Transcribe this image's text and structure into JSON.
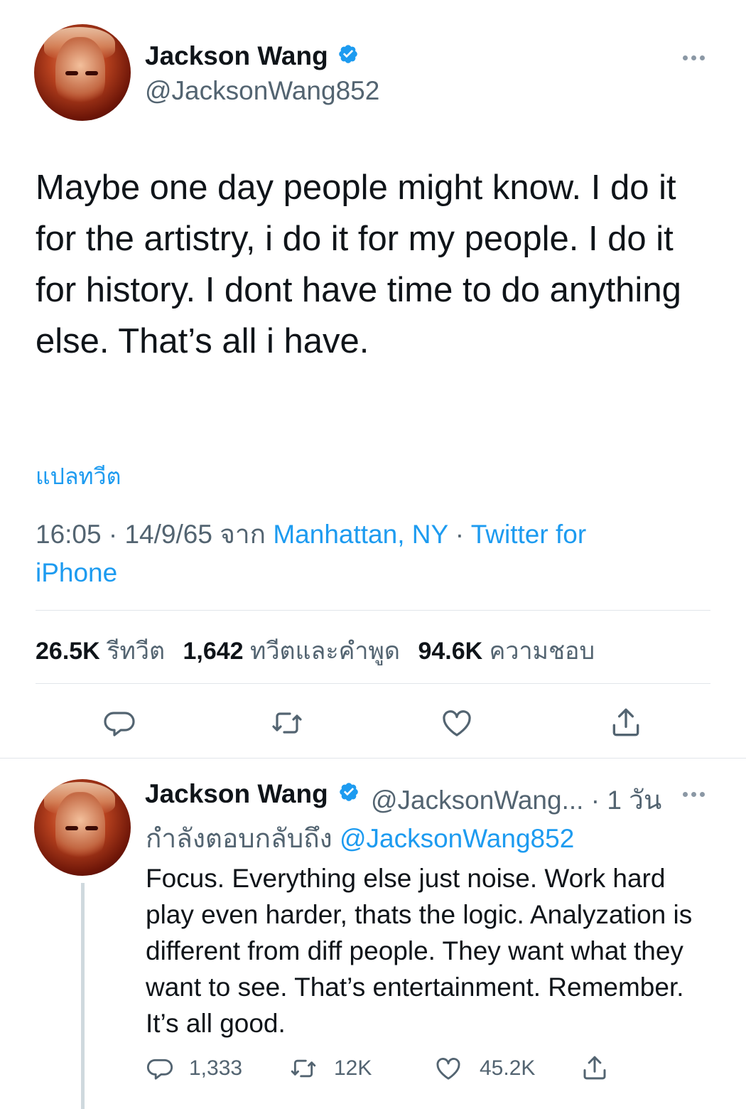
{
  "tweet": {
    "author_name": "Jackson Wang",
    "author_handle": "@JacksonWang852",
    "text": "Maybe one day people might know. I do it for the artistry, i do it for my people. I do it for history. I dont have time to do anything else. That’s all i have.",
    "translate_label": "แปลทวีต",
    "time": "16:05",
    "date": "14/9/65",
    "from_label": "จาก",
    "location": "Manhattan, NY",
    "source": "Twitter for iPhone",
    "stats": {
      "retweets": "26.5K",
      "retweets_label": "รีทวีต",
      "quotes": "1,642",
      "quotes_label": "ทวีตและคำพูด",
      "likes": "94.6K",
      "likes_label": "ความชอบ"
    }
  },
  "reply": {
    "author_name": "Jackson Wang",
    "author_handle": "@JacksonWang...",
    "age": "1 วัน",
    "replying_to_label": "กำลังตอบกลับถึง",
    "replying_to_handle": "@JacksonWang852",
    "text": "Focus. Everything else just noise. Work hard play even harder, thats the logic. Analyzation is different from diff people. They want what they want to see. That’s entertainment. Remember. It’s all good.",
    "counts": {
      "replies": "1,333",
      "retweets": "12K",
      "likes": "45.2K"
    }
  },
  "colors": {
    "link": "#1d9bf0",
    "secondary_text": "#536471",
    "icon": "#536471",
    "verified": "#1d9bf0",
    "divider": "#e1e6ea"
  },
  "icons": [
    "verified-badge-icon",
    "more-icon",
    "reply-icon",
    "retweet-icon",
    "like-icon",
    "share-icon"
  ]
}
